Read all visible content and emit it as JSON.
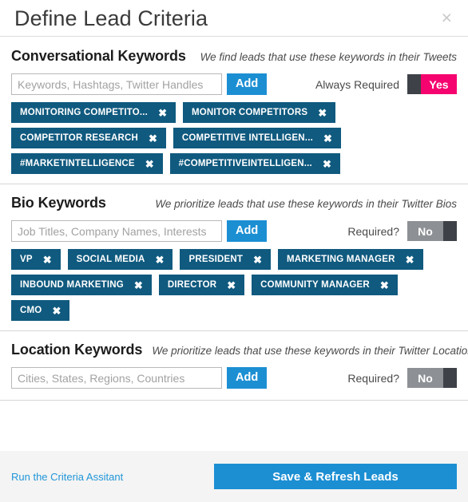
{
  "header": {
    "title": "Define Lead Criteria",
    "close_icon": "close-icon",
    "close_glyph": "×"
  },
  "sections": [
    {
      "id": "conversational",
      "title": "Conversational Keywords",
      "subtitle": "We find leads that use these keywords in their Tweets",
      "input_placeholder": "Keywords, Hashtags, Twitter Handles",
      "input_value": "",
      "add_label": "Add",
      "required_label": "Always Required",
      "toggle_value": "Yes",
      "toggle_state": "on",
      "tags": [
        "MONITORING COMPETITO...",
        "MONITOR COMPETITORS",
        "COMPETITOR RESEARCH",
        "COMPETITIVE INTELLIGEN...",
        "#MARKETINTELLIGENCE",
        "#COMPETITIVEINTELLIGEN..."
      ]
    },
    {
      "id": "bio",
      "title": "Bio Keywords",
      "subtitle": "We prioritize leads that use these keywords in their Twitter Bios",
      "input_placeholder": "Job Titles, Company Names, Interests",
      "input_value": "",
      "add_label": "Add",
      "required_label": "Required?",
      "toggle_value": "No",
      "toggle_state": "off",
      "tags": [
        "VP",
        "SOCIAL MEDIA",
        "PRESIDENT",
        "MARKETING MANAGER",
        "INBOUND MARKETING",
        "DIRECTOR",
        "COMMUNITY MANAGER",
        "CMO"
      ]
    },
    {
      "id": "location",
      "title": "Location Keywords",
      "subtitle": "We prioritize leads that use these keywords in their Twitter Location",
      "input_placeholder": "Cities, States, Regions, Countries",
      "input_value": "",
      "add_label": "Add",
      "required_label": "Required?",
      "toggle_value": "No",
      "toggle_state": "off",
      "tags": []
    }
  ],
  "footer": {
    "assistant_link": "Run the Criteria Assitant",
    "save_label": "Save & Refresh Leads"
  },
  "tag_remove_glyph": "✖",
  "colors": {
    "tag_blue": "#105a7f",
    "button_blue": "#1c8fd3",
    "toggle_on": "#f5046f",
    "toggle_off": "#8d9094",
    "toggle_knob": "#3e4248",
    "footer_bg": "#f4f4f4"
  }
}
